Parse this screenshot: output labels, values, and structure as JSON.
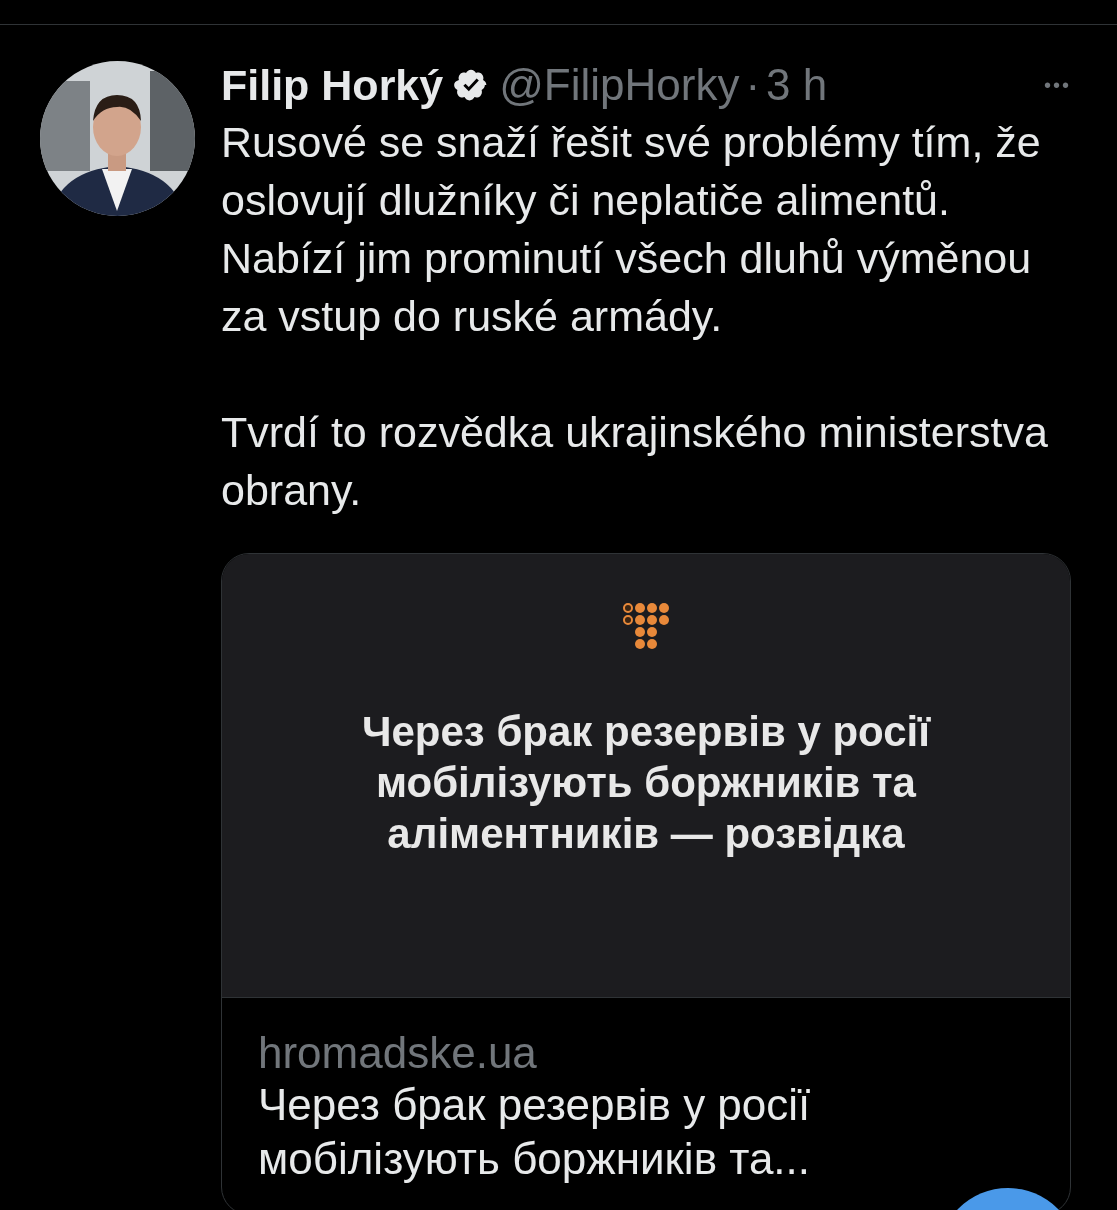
{
  "tweet": {
    "author_name": "Filip Horký",
    "verified": true,
    "handle": "@FilipHorky",
    "separator": "·",
    "time": "3 h",
    "more": "•••",
    "paragraphs": [
      "Rusové se snaží řešit své problémy tím, že oslovují dlužníky či neplatiče alimentů. Nabízí jim prominutí všech dluhů výměnou za vstup do ruské armády.",
      "Tvrdí to rozvědka ukrajinského ministerstva obrany."
    ],
    "link_card": {
      "image_headline": "Через брак резервів у росії мобілізують боржників та аліментників — розвідка",
      "domain": "hromadske.ua",
      "title": "Через брак резервів у росії",
      "title_line_2": "мобілізують боржників та..."
    }
  }
}
